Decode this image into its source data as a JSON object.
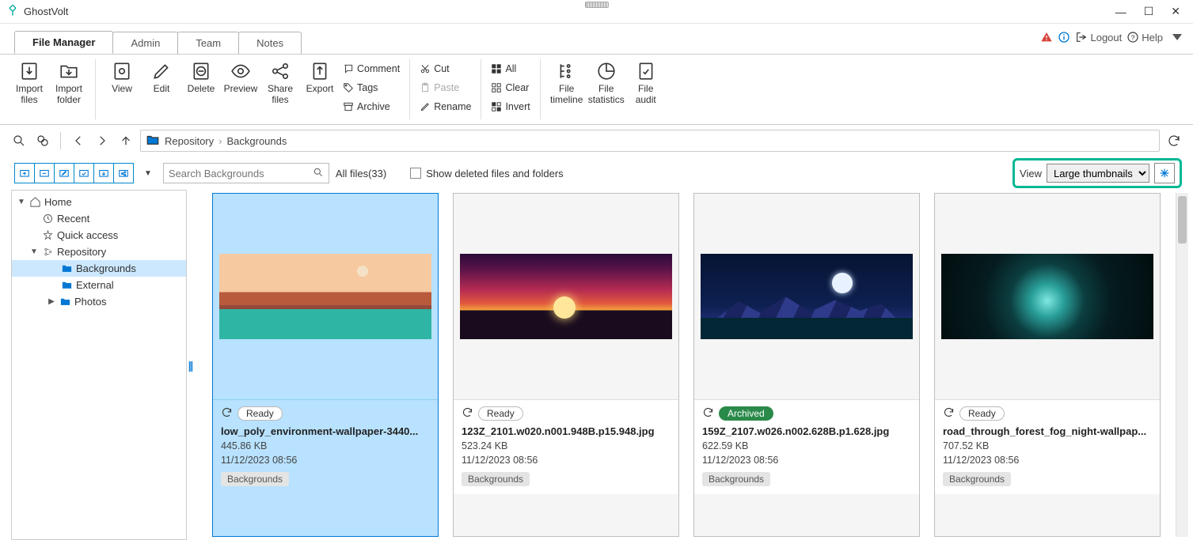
{
  "window": {
    "title": "GhostVolt"
  },
  "header": {
    "logout": "Logout",
    "help": "Help"
  },
  "tabs": [
    {
      "label": "File Manager",
      "active": true
    },
    {
      "label": "Admin"
    },
    {
      "label": "Team"
    },
    {
      "label": "Notes"
    }
  ],
  "ribbon": {
    "import_files": "Import\nfiles",
    "import_folder": "Import\nfolder",
    "view": "View",
    "edit": "Edit",
    "delete": "Delete",
    "preview": "Preview",
    "share_files": "Share\nfiles",
    "export": "Export",
    "comment": "Comment",
    "tags": "Tags",
    "archive": "Archive",
    "cut": "Cut",
    "paste": "Paste",
    "rename": "Rename",
    "all": "All",
    "clear": "Clear",
    "invert": "Invert",
    "file_timeline": "File\ntimeline",
    "file_statistics": "File\nstatistics",
    "file_audit": "File\naudit"
  },
  "breadcrumb": {
    "root": "Repository",
    "current": "Backgrounds"
  },
  "search": {
    "placeholder": "Search Backgrounds"
  },
  "filter": {
    "all_files": "All files(33)"
  },
  "show_deleted": "Show deleted files and folders",
  "view": {
    "label": "View",
    "selection": "Large thumbnails"
  },
  "tree": {
    "home": "Home",
    "recent": "Recent",
    "quick_access": "Quick access",
    "repository": "Repository",
    "backgrounds": "Backgrounds",
    "external": "External",
    "photos": "Photos"
  },
  "items": [
    {
      "status": "Ready",
      "status_kind": "ready",
      "name": "low_poly_environment-wallpaper-3440...",
      "size": "445.86 KB",
      "date": "11/12/2023 08:56",
      "tag": "Backgrounds",
      "selected": true,
      "art": "art1"
    },
    {
      "status": "Ready",
      "status_kind": "ready",
      "name": "123Z_2101.w020.n001.948B.p15.948.jpg",
      "size": "523.24 KB",
      "date": "11/12/2023 08:56",
      "tag": "Backgrounds",
      "art": "art2"
    },
    {
      "status": "Archived",
      "status_kind": "archived",
      "name": "159Z_2107.w026.n002.628B.p1.628.jpg",
      "size": "622.59 KB",
      "date": "11/12/2023 08:56",
      "tag": "Backgrounds",
      "art": "art3"
    },
    {
      "status": "Ready",
      "status_kind": "ready",
      "name": "road_through_forest_fog_night-wallpap...",
      "size": "707.52 KB",
      "date": "11/12/2023 08:56",
      "tag": "Backgrounds",
      "art": "art4"
    }
  ]
}
